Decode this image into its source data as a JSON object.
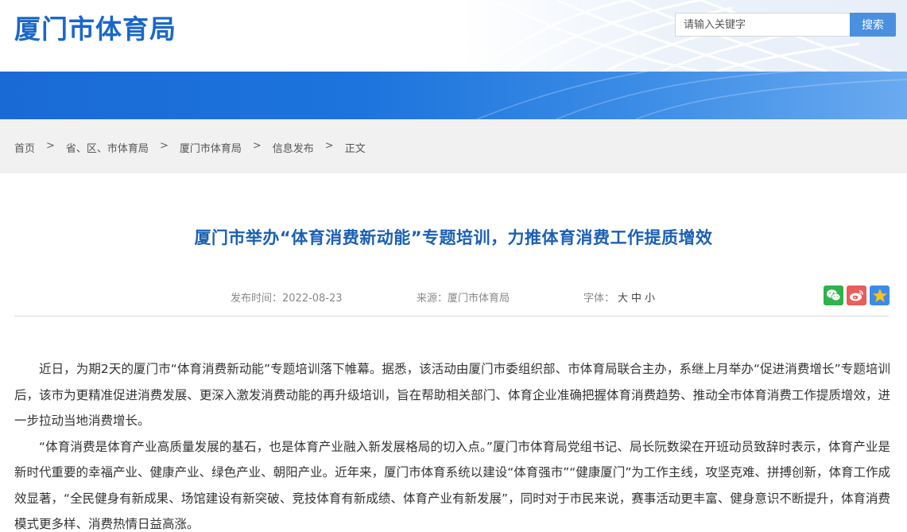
{
  "header": {
    "logo": "厦门市体育局",
    "search_placeholder": "请输入关键字",
    "search_button": "搜索"
  },
  "breadcrumb": {
    "items": [
      "首页",
      "省、区、市体育局",
      "厦门市体育局",
      "信息发布",
      "正文"
    ],
    "separator": ">"
  },
  "article": {
    "title": "厦门市举办“体育消费新动能”专题培训，力推体育消费工作提质增效",
    "date_label": "发布时间：",
    "date": "2022-08-23",
    "source_label": "来源：",
    "source": "厦门市体育局",
    "font_label": "字体：",
    "font_sizes": [
      "大",
      "中",
      "小"
    ],
    "share_icons": [
      "wechat-icon",
      "weibo-icon",
      "qzone-icon"
    ],
    "paragraphs": [
      "近日，为期2天的厦门市“体育消费新动能”专题培训落下帷幕。据悉，该活动由厦门市委组织部、市体育局联合主办，系继上月举办“促进消费增长”专题培训后，该市为更精准促进消费发展、更深入激发消费动能的再升级培训，旨在帮助相关部门、体育企业准确把握体育消费趋势、推动全市体育消费工作提质增效，进一步拉动当地消费增长。",
      "“体育消费是体育产业高质量发展的基石，也是体育产业融入新发展格局的切入点。”厦门市体育局党组书记、局长阮数梁在开班动员致辞时表示，体育产业是新时代重要的幸福产业、健康产业、绿色产业、朝阳产业。近年来，厦门市体育系统以建设“体育强市”“健康厦门”为工作主线，攻坚克难、拼搏创新，体育工作成效显著，“全民健身有新成果、场馆建设有新突破、竞技体育有新成绩、体育产业有新发展”，同时对于市民来说，赛事活动更丰富、健身意识不断提升，体育消费模式更多样、消费热情日益高涨。"
    ]
  },
  "colors": {
    "brand_blue": "#1a67c9",
    "title_blue": "#1a5fb4",
    "search_button": "#4a8fe0",
    "wechat_green": "#2fb34a",
    "weibo_red": "#ea5d5c",
    "qzone_blue": "#3d8be8"
  }
}
